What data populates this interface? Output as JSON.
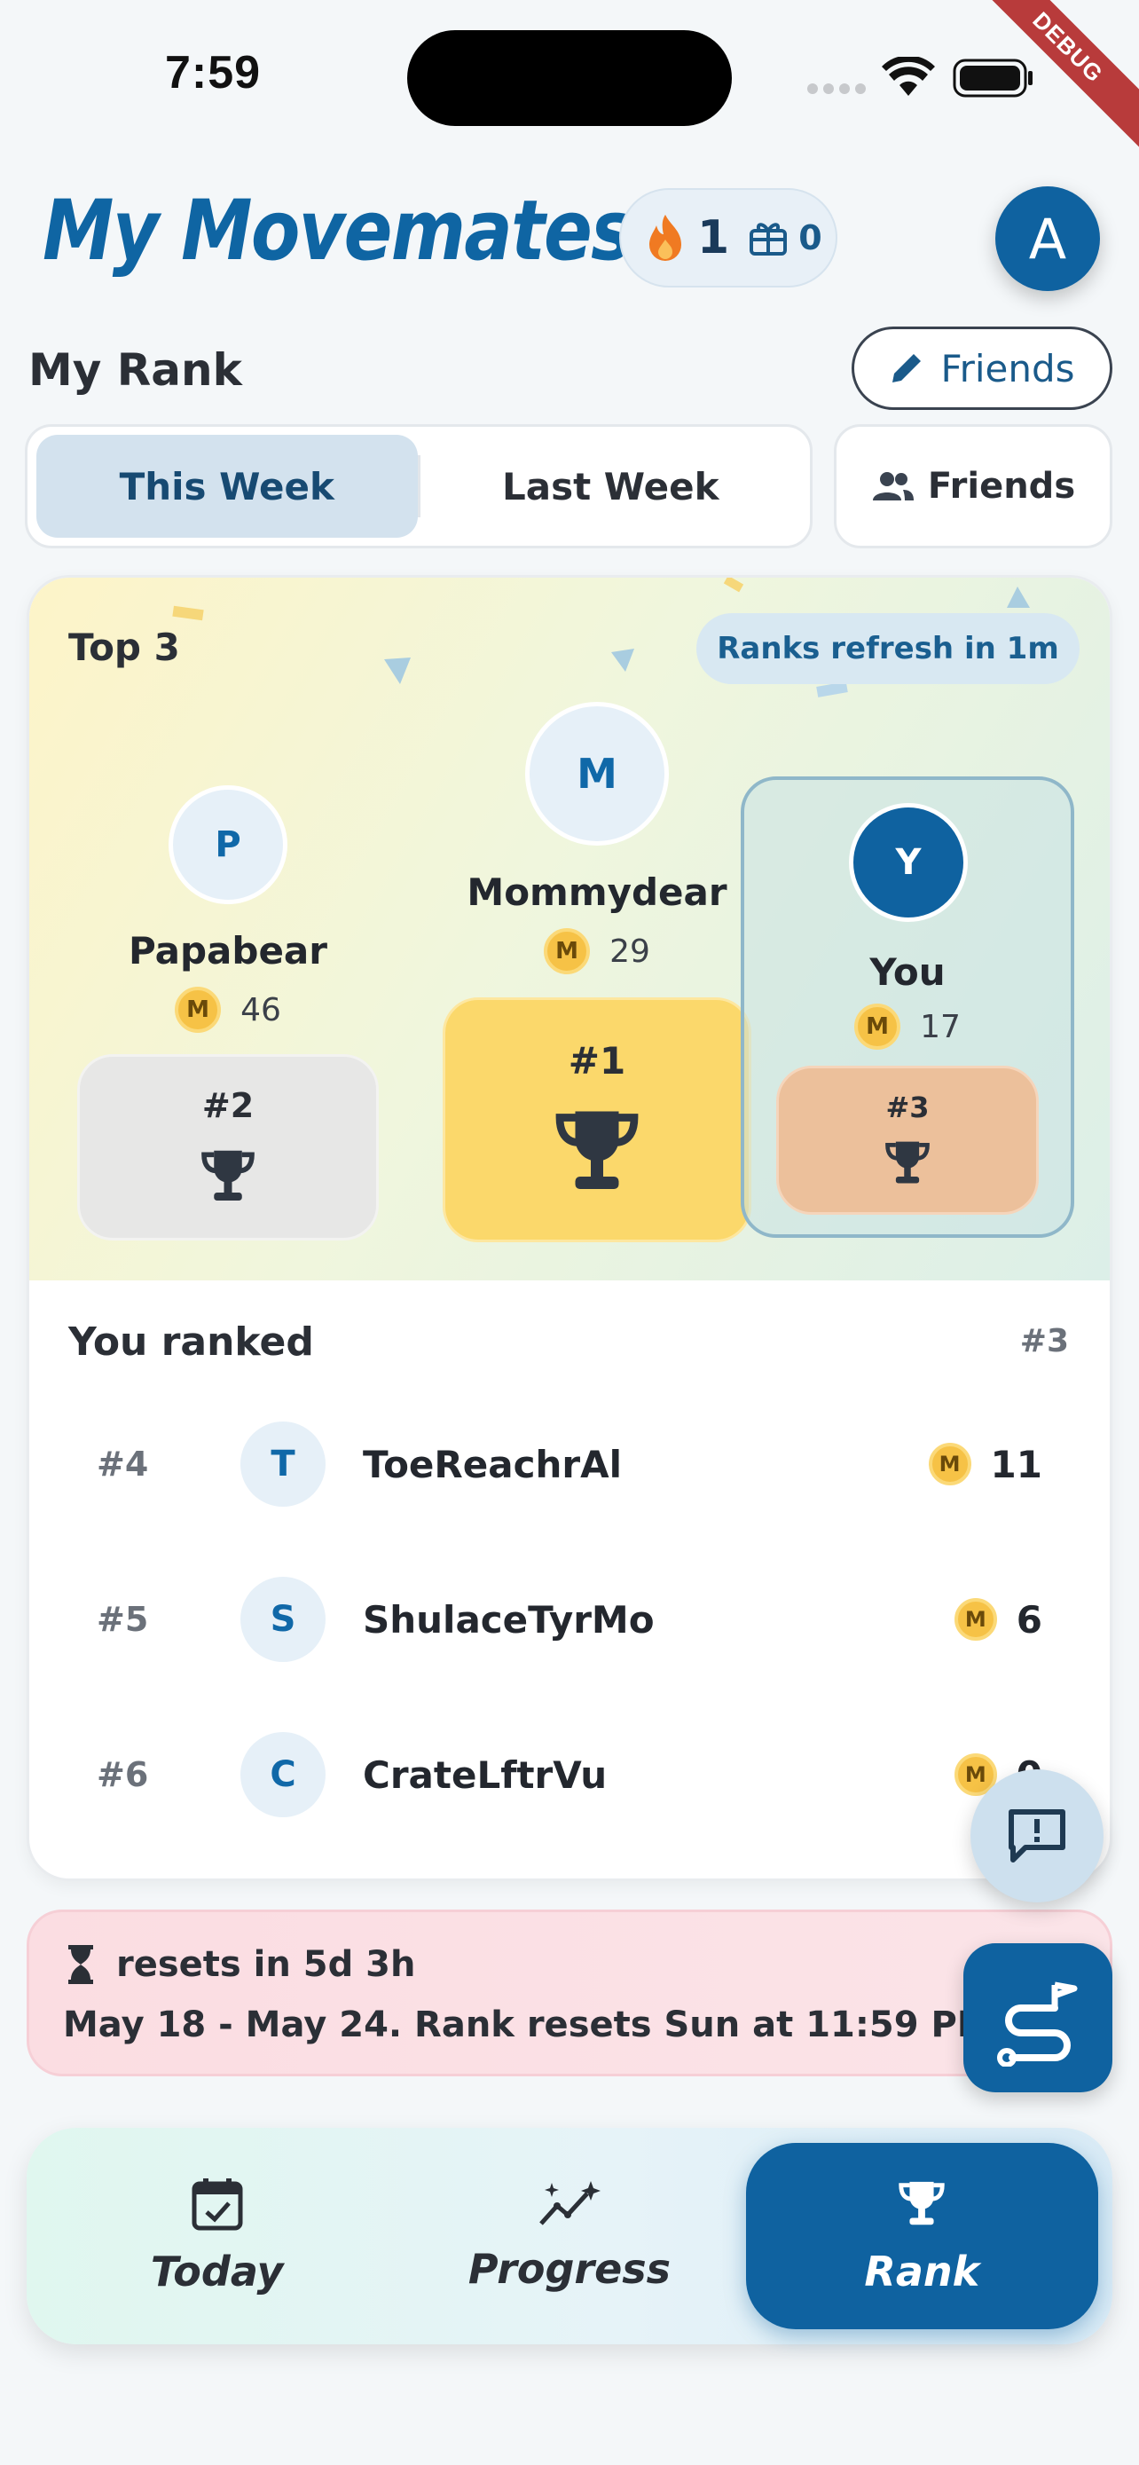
{
  "status_bar": {
    "time": "7:59",
    "debug_label": "DEBUG"
  },
  "header": {
    "title": "My Movemates",
    "streak_count": "1",
    "gift_count": "0",
    "avatar_initial": "A"
  },
  "rank_section": {
    "title": "My Rank",
    "edit_friends_label": "Friends",
    "tabs": [
      {
        "label": "This Week",
        "active": true
      },
      {
        "label": "Last Week",
        "active": false
      }
    ],
    "filter_label": "Friends"
  },
  "podium": {
    "title": "Top 3",
    "refresh_label": "Ranks refresh in 1m",
    "places": [
      {
        "initial": "P",
        "name": "Papabear",
        "coin": "M",
        "score": "46",
        "rank": "#2"
      },
      {
        "initial": "M",
        "name": "Mommydear",
        "coin": "M",
        "score": "29",
        "rank": "#1"
      },
      {
        "initial": "Y",
        "name": "You",
        "coin": "M",
        "score": "17",
        "rank": "#3"
      }
    ]
  },
  "ranked_list": {
    "title": "You ranked",
    "my_rank": "#3",
    "rows": [
      {
        "rank": "#4",
        "initial": "T",
        "name": "ToeReachrAl",
        "coin": "M",
        "score": "11"
      },
      {
        "rank": "#5",
        "initial": "S",
        "name": "ShulaceTyrMo",
        "coin": "M",
        "score": "6"
      },
      {
        "rank": "#6",
        "initial": "C",
        "name": "CrateLftrVu",
        "coin": "M",
        "score": "0"
      }
    ]
  },
  "reset_banner": {
    "countdown": "resets in 5d 3h",
    "detail": "May 18 - May 24. Rank resets Sun at 11:59 PM PDT"
  },
  "bottom_nav": [
    {
      "label": "Today",
      "icon": "calendar-check-icon",
      "active": false
    },
    {
      "label": "Progress",
      "icon": "sparkle-chart-icon",
      "active": false
    },
    {
      "label": "Rank",
      "icon": "trophy-icon",
      "active": true
    }
  ],
  "colors": {
    "primary": "#0f62a0",
    "gold": "#fbd86b",
    "silver": "#e7e7e6",
    "bronze": "#ecc09b",
    "coin": "#f6c246"
  }
}
